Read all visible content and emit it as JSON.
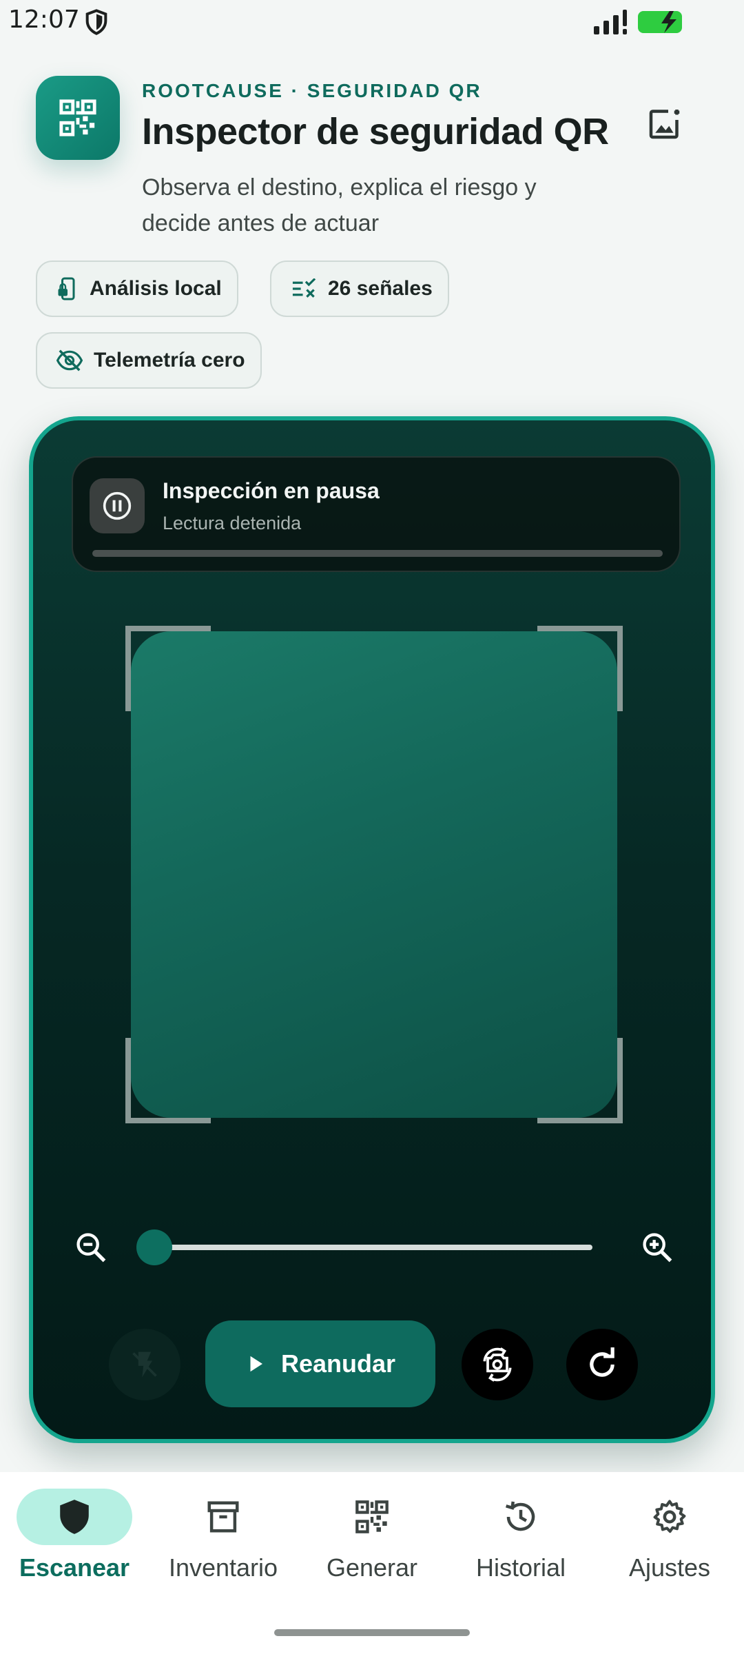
{
  "status_bar": {
    "time": "12:07",
    "icons": [
      "shield-icon",
      "signal-icon",
      "battery-charging-icon"
    ],
    "battery_color": "#2ecc40"
  },
  "header": {
    "eyebrow": "ROOTCAUSE · SEGURIDAD QR",
    "title": "Inspector de seguridad QR",
    "subtitle": "Observa el destino, explica el riesgo y decide antes de actuar",
    "app_icon": "qr-code-icon",
    "action_icon": "add-image-icon"
  },
  "chips": [
    {
      "label": "Análisis local",
      "icon": "phone-lock-icon"
    },
    {
      "label": "26 señales",
      "icon": "checklist-icon"
    },
    {
      "label": "Telemetría cero",
      "icon": "eye-off-icon"
    }
  ],
  "scanner": {
    "status_title": "Inspección en pausa",
    "status_sub": "Lectura detenida",
    "status_icon": "pause-icon",
    "zoom_level": 0,
    "resume_label": "Reanudar",
    "controls": [
      "flash-off-icon",
      "play-icon",
      "switch-camera-icon",
      "refresh-icon"
    ]
  },
  "colors": {
    "accent": "#0e6b5e",
    "border": "#14a58d",
    "nav_active_pill": "#b6f0e3"
  },
  "nav": {
    "items": [
      {
        "label": "Escanear",
        "icon": "shield-icon",
        "active": true
      },
      {
        "label": "Inventario",
        "icon": "archive-icon",
        "active": false
      },
      {
        "label": "Generar",
        "icon": "qr-code-icon",
        "active": false
      },
      {
        "label": "Historial",
        "icon": "history-icon",
        "active": false
      },
      {
        "label": "Ajustes",
        "icon": "gear-icon",
        "active": false
      }
    ]
  }
}
